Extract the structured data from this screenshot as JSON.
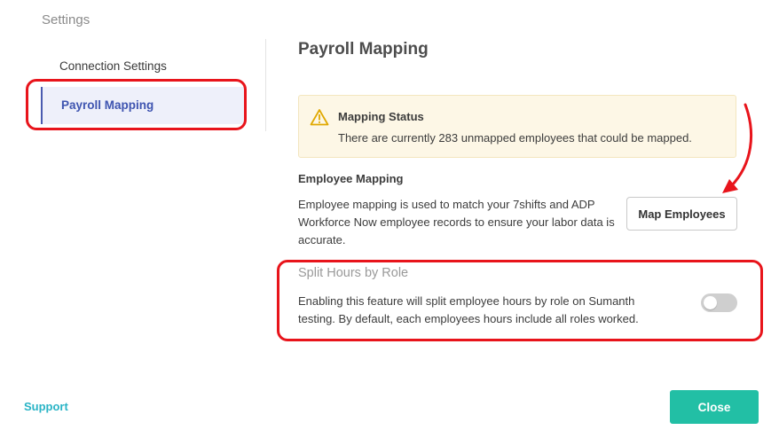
{
  "sidebar": {
    "title": "Settings",
    "items": [
      {
        "label": "Connection Settings"
      },
      {
        "label": "Payroll Mapping"
      }
    ]
  },
  "main": {
    "title": "Payroll Mapping",
    "status": {
      "icon": "warning-icon",
      "title": "Mapping Status",
      "text": "There are currently 283 unmapped employees that could be mapped."
    },
    "employee_mapping": {
      "title": "Employee Mapping",
      "description": "Employee mapping is used to match your 7shifts and ADP Workforce Now employee records to ensure your labor data is accurate.",
      "button_label": "Map Employees"
    },
    "split_hours": {
      "title": "Split Hours by Role",
      "description": "Enabling this feature will split employee hours by role on Sumanth testing. By default, each employees hours include all roles worked.",
      "enabled": false
    }
  },
  "footer": {
    "support_label": "Support",
    "close_label": "Close"
  },
  "colors": {
    "accent_active_nav": "#3e54b0",
    "status_background": "#fdf7e6",
    "close_button": "#22bfa5",
    "support_link": "#2ab4c6",
    "annotation": "#e8141b"
  }
}
